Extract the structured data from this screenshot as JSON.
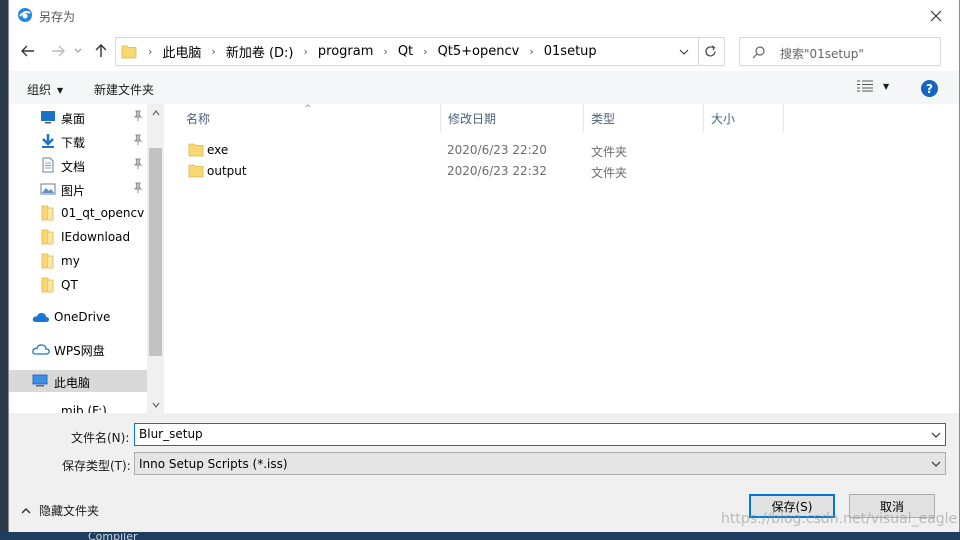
{
  "window": {
    "title": "另存为"
  },
  "nav": {
    "path": [
      "此电脑",
      "新加卷 (D:)",
      "program",
      "Qt",
      "Qt5+opencv",
      "01setup"
    ],
    "search_placeholder": "搜索\"01setup\""
  },
  "toolbar": {
    "organize_label": "组织",
    "new_folder_label": "新建文件夹",
    "help_label": "?"
  },
  "sidebar": {
    "items": [
      {
        "label": "桌面",
        "icon": "desktop-icon",
        "pinned": true
      },
      {
        "label": "下载",
        "icon": "download-icon",
        "pinned": true
      },
      {
        "label": "文档",
        "icon": "document-icon",
        "pinned": true
      },
      {
        "label": "图片",
        "icon": "picture-icon",
        "pinned": true
      },
      {
        "label": "01_qt_opencv",
        "icon": "folder-icon",
        "pinned": false
      },
      {
        "label": "IEdownload",
        "icon": "folder-icon",
        "pinned": false
      },
      {
        "label": "my",
        "icon": "folder-icon",
        "pinned": false
      },
      {
        "label": "QT",
        "icon": "folder-icon",
        "pinned": false
      },
      {
        "label": "OneDrive",
        "icon": "cloud-icon",
        "pinned": false
      },
      {
        "label": "WPS网盘",
        "icon": "cloud-outline-icon",
        "pinned": false
      },
      {
        "label": "此电脑",
        "icon": "computer-icon",
        "pinned": false,
        "selected": true
      },
      {
        "label": "mib (F:)",
        "icon": "drive-icon",
        "pinned": false
      }
    ]
  },
  "filelist": {
    "columns": [
      "名称",
      "修改日期",
      "类型",
      "大小"
    ],
    "rows": [
      {
        "name": "exe",
        "date": "2020/6/23 22:20",
        "type": "文件夹"
      },
      {
        "name": "output",
        "date": "2020/6/23 22:32",
        "type": "文件夹"
      }
    ]
  },
  "form": {
    "filename_label": "文件名(N):",
    "filename_value": "Blur_setup",
    "filetype_label": "保存类型(T):",
    "filetype_value": "Inno Setup Scripts (*.iss)",
    "hide_folders_label": "隐藏文件夹",
    "save_label": "保存(S)",
    "cancel_label": "取消"
  },
  "background": {
    "taskbar_text": "Compiler"
  },
  "watermark": "https://blog.csdn.net/visual_eagle",
  "colors": {
    "accent": "#0078d7",
    "folder": "#f8d775",
    "help": "#1565c0"
  }
}
